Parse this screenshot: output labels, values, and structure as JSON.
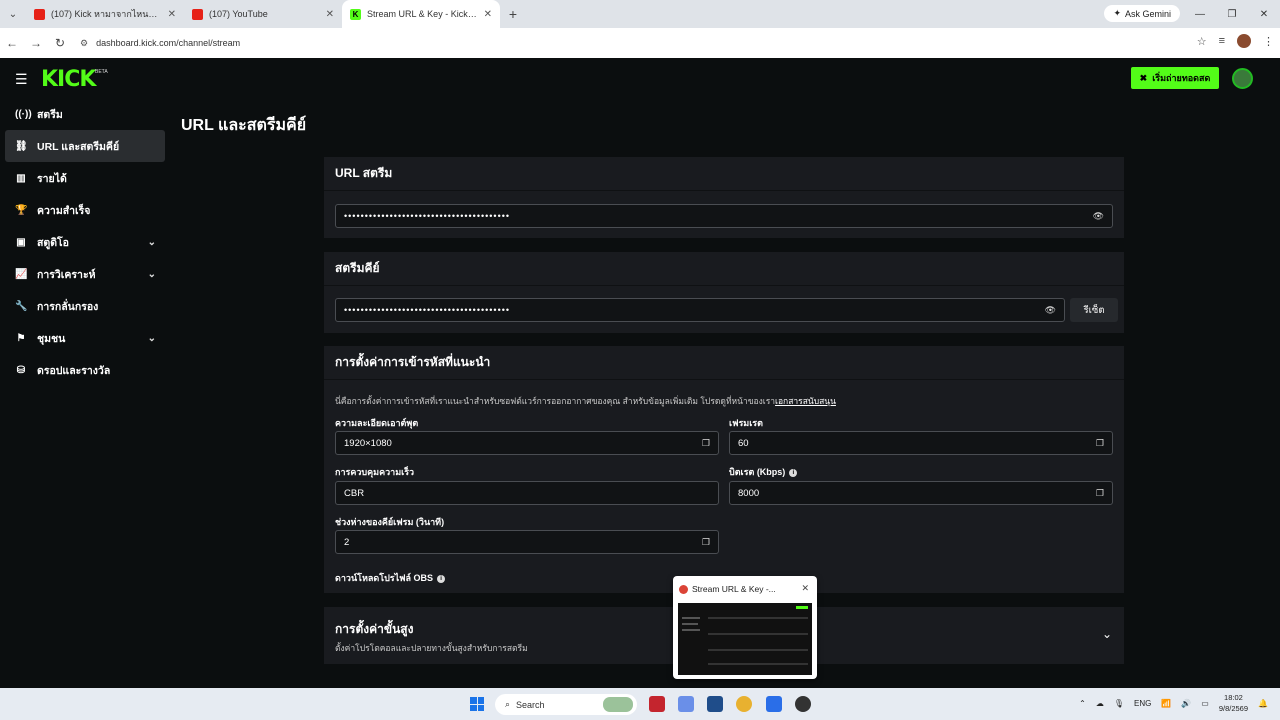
{
  "browser": {
    "tabs": [
      {
        "title": "(107) Kick หามาจากไหน? สิ่งที่มีอ...",
        "favicon": "youtube-icon",
        "active": false
      },
      {
        "title": "(107) YouTube",
        "favicon": "youtube-icon",
        "active": false
      },
      {
        "title": "Stream URL & Key - Kick Dashb...",
        "favicon": "kick-icon",
        "active": true
      }
    ],
    "gemini_label": "Ask Gemini",
    "url": "dashboard.kick.com/channel/stream"
  },
  "header": {
    "logo": "KICK",
    "beta": "BETA",
    "go_live_label": "เริ่มถ่ายทอดสด"
  },
  "sidebar": {
    "items": [
      {
        "label": "สตรีม",
        "icon": "broadcast-icon",
        "has_chevron": false,
        "active": false
      },
      {
        "label": "URL และสตรีมคีย์",
        "icon": "link-icon",
        "has_chevron": false,
        "active": true
      },
      {
        "label": "รายได้",
        "icon": "chart-icon",
        "has_chevron": false,
        "active": false
      },
      {
        "label": "ความสำเร็จ",
        "icon": "trophy-icon",
        "has_chevron": false,
        "active": false
      },
      {
        "label": "สตูดิโอ",
        "icon": "studio-icon",
        "has_chevron": true,
        "active": false
      },
      {
        "label": "การวิเคราะห์",
        "icon": "analytics-icon",
        "has_chevron": true,
        "active": false
      },
      {
        "label": "การกลั่นกรอง",
        "icon": "wrench-icon",
        "has_chevron": false,
        "active": false
      },
      {
        "label": "ชุมชน",
        "icon": "community-icon",
        "has_chevron": true,
        "active": false
      },
      {
        "label": "ดรอปและรางวัล",
        "icon": "drops-icon",
        "has_chevron": false,
        "active": false
      }
    ]
  },
  "main": {
    "page_title": "URL และสตรีมคีย์",
    "stream_url": {
      "heading": "URL สตรีม",
      "value": "••••••••••••••••••••••••••••••••••••••••"
    },
    "stream_key": {
      "heading": "สตรีมคีย์",
      "value": "••••••••••••••••••••••••••••••••••••••••",
      "reset_label": "รีเซ็ต"
    },
    "encoder": {
      "heading": "การตั้งค่าการเข้ารหัสที่แนะนำ",
      "description": "นี่คือการตั้งค่าการเข้ารหัสที่เราแนะนำสำหรับซอฟต์แวร์การออกอากาศของคุณ สำหรับข้อมูลเพิ่มเติม โปรดดูที่หน้าของเรา",
      "description_link": "เอกสารสนับสนุน",
      "resolution_label": "ความละเอียดเอาต์พุต",
      "resolution_value": "1920×1080",
      "framerate_label": "เฟรมเรต",
      "framerate_value": "60",
      "rate_control_label": "การควบคุมความเร็ว",
      "rate_control_value": "CBR",
      "bitrate_label": "บิตเรต (Kbps)",
      "bitrate_value": "8000",
      "keyframe_label": "ช่วงห่างของคีย์เฟรม (วินาที)",
      "keyframe_value": "2",
      "obs_label": "ดาวน์โหลดโปรไฟล์ OBS"
    },
    "advanced": {
      "heading": "การตั้งค่าขั้นสูง",
      "subtitle": "ตั้งค่าโปรโตคอลและปลายทางขั้นสูงสำหรับการสตรีม"
    }
  },
  "preview": {
    "title": "Stream URL & Key -..."
  },
  "taskbar": {
    "search_placeholder": "Search",
    "lang": "ENG",
    "time": "18:02",
    "date": "9/8/2569"
  },
  "colors": {
    "accent": "#53fc18",
    "background": "#0b0e0f",
    "card": "#191b1f"
  }
}
